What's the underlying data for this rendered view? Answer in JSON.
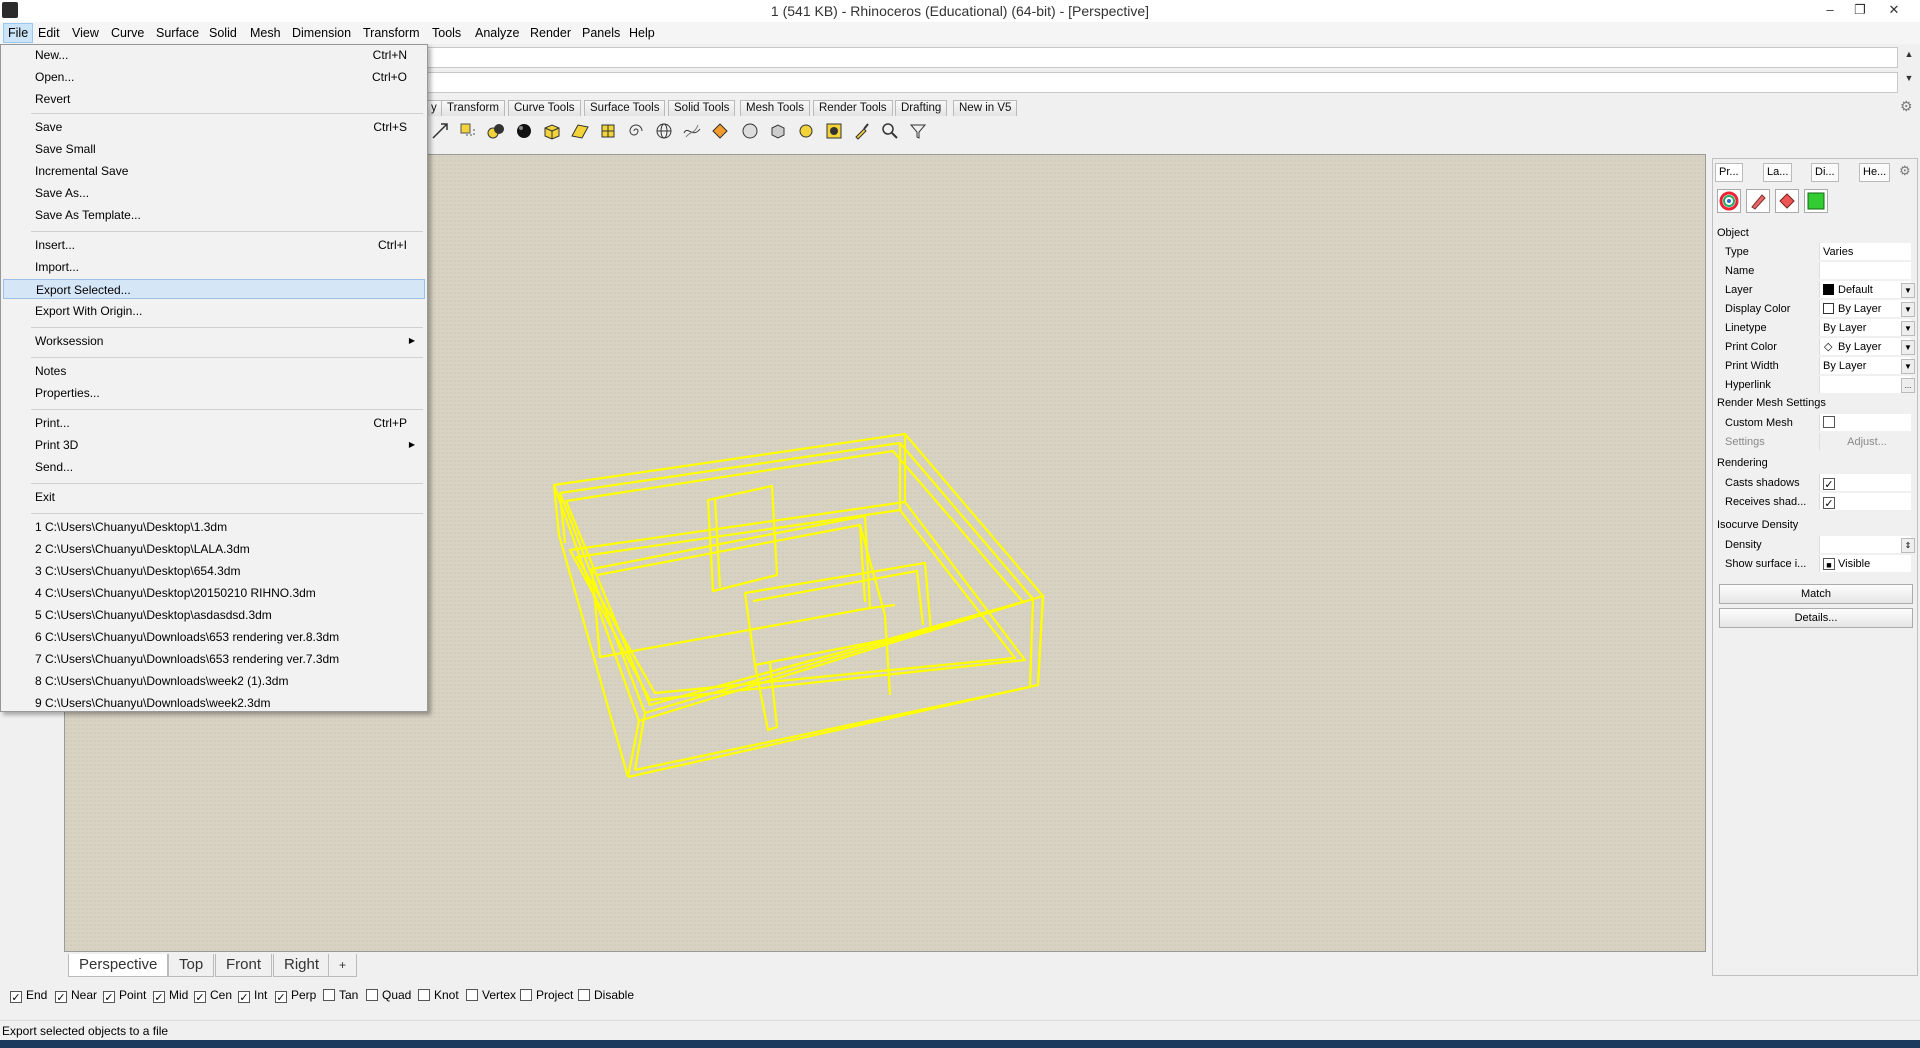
{
  "window": {
    "title": "1 (541 KB) - Rhinoceros (Educational) (64-bit) - [Perspective]",
    "minimize": "–",
    "restore": "❐",
    "close": "✕"
  },
  "menubar": [
    "File",
    "Edit",
    "View",
    "Curve",
    "Surface",
    "Solid",
    "Mesh",
    "Dimension",
    "Transform",
    "Tools",
    "Analyze",
    "Render",
    "Panels",
    "Help"
  ],
  "toolbar_tabs": [
    "y",
    "Transform",
    "Curve Tools",
    "Surface Tools",
    "Solid Tools",
    "Mesh Tools",
    "Render Tools",
    "Drafting",
    "New in V5"
  ],
  "file_menu": {
    "items": [
      {
        "label": "New...",
        "shortcut": "Ctrl+N"
      },
      {
        "label": "Open...",
        "shortcut": "Ctrl+O"
      },
      {
        "label": "Revert",
        "shortcut": ""
      },
      {
        "label": "Save",
        "shortcut": "Ctrl+S"
      },
      {
        "label": "Save Small",
        "shortcut": ""
      },
      {
        "label": "Incremental Save",
        "shortcut": ""
      },
      {
        "label": "Save As...",
        "shortcut": ""
      },
      {
        "label": "Save As Template...",
        "shortcut": ""
      },
      {
        "label": "Insert...",
        "shortcut": "Ctrl+I"
      },
      {
        "label": "Import...",
        "shortcut": ""
      },
      {
        "label": "Export Selected...",
        "shortcut": ""
      },
      {
        "label": "Export With Origin...",
        "shortcut": ""
      },
      {
        "label": "Worksession",
        "shortcut": ""
      },
      {
        "label": "Notes",
        "shortcut": ""
      },
      {
        "label": "Properties...",
        "shortcut": ""
      },
      {
        "label": "Print...",
        "shortcut": "Ctrl+P"
      },
      {
        "label": "Print 3D",
        "shortcut": ""
      },
      {
        "label": "Send...",
        "shortcut": ""
      },
      {
        "label": "Exit",
        "shortcut": ""
      }
    ],
    "recent": [
      "1 C:\\Users\\Chuanyu\\Desktop\\1.3dm",
      "2 C:\\Users\\Chuanyu\\Desktop\\LALA.3dm",
      "3 C:\\Users\\Chuanyu\\Desktop\\654.3dm",
      "4 C:\\Users\\Chuanyu\\Desktop\\20150210 RIHNO.3dm",
      "5 C:\\Users\\Chuanyu\\Desktop\\asdasdsd.3dm",
      "6 C:\\Users\\Chuanyu\\Downloads\\653 rendering ver.8.3dm",
      "7 C:\\Users\\Chuanyu\\Downloads\\653 rendering ver.7.3dm",
      "8 C:\\Users\\Chuanyu\\Downloads\\week2 (1).3dm",
      "9 C:\\Users\\Chuanyu\\Downloads\\week2.3dm"
    ]
  },
  "viewport_tabs": [
    "Perspective",
    "Top",
    "Front",
    "Right",
    "+"
  ],
  "osnaps": [
    {
      "label": "End",
      "checked": true
    },
    {
      "label": "Near",
      "checked": true
    },
    {
      "label": "Point",
      "checked": true
    },
    {
      "label": "Mid",
      "checked": true
    },
    {
      "label": "Cen",
      "checked": true
    },
    {
      "label": "Int",
      "checked": true
    },
    {
      "label": "Perp",
      "checked": true
    },
    {
      "label": "Tan",
      "checked": false
    },
    {
      "label": "Quad",
      "checked": false
    },
    {
      "label": "Knot",
      "checked": false
    },
    {
      "label": "Vertex",
      "checked": false
    },
    {
      "label": "Project",
      "checked": false
    },
    {
      "label": "Disable",
      "checked": false
    }
  ],
  "status": "Export selected objects to a file",
  "panel": {
    "tabs": [
      "Pr...",
      "La...",
      "Di...",
      "He..."
    ],
    "object_title": "Object",
    "rows": [
      {
        "k": "Type",
        "v": "Varies"
      },
      {
        "k": "Name",
        "v": ""
      },
      {
        "k": "Layer",
        "v": "Default"
      },
      {
        "k": "Display Color",
        "v": "By Layer"
      },
      {
        "k": "Linetype",
        "v": "By Layer"
      },
      {
        "k": "Print Color",
        "v": "By Layer"
      },
      {
        "k": "Print Width",
        "v": "By Layer"
      },
      {
        "k": "Hyperlink",
        "v": ""
      }
    ],
    "render_mesh_title": "Render Mesh Settings",
    "custom_mesh": "Custom Mesh",
    "settings": "Settings",
    "adjust": "Adjust...",
    "rendering_title": "Rendering",
    "casts_shadows": "Casts shadows",
    "receives_shadows": "Receives shad...",
    "isocurve_title": "Isocurve Density",
    "density": "Density",
    "show_surface": "Show surface i...",
    "visible": "Visible",
    "match": "Match",
    "details": "Details...",
    "ellipsis": "..."
  },
  "colors": {
    "wireframe": "#ffff00",
    "viewport_bg": "#d8d2c3",
    "highlight": "#d5e6f7"
  }
}
